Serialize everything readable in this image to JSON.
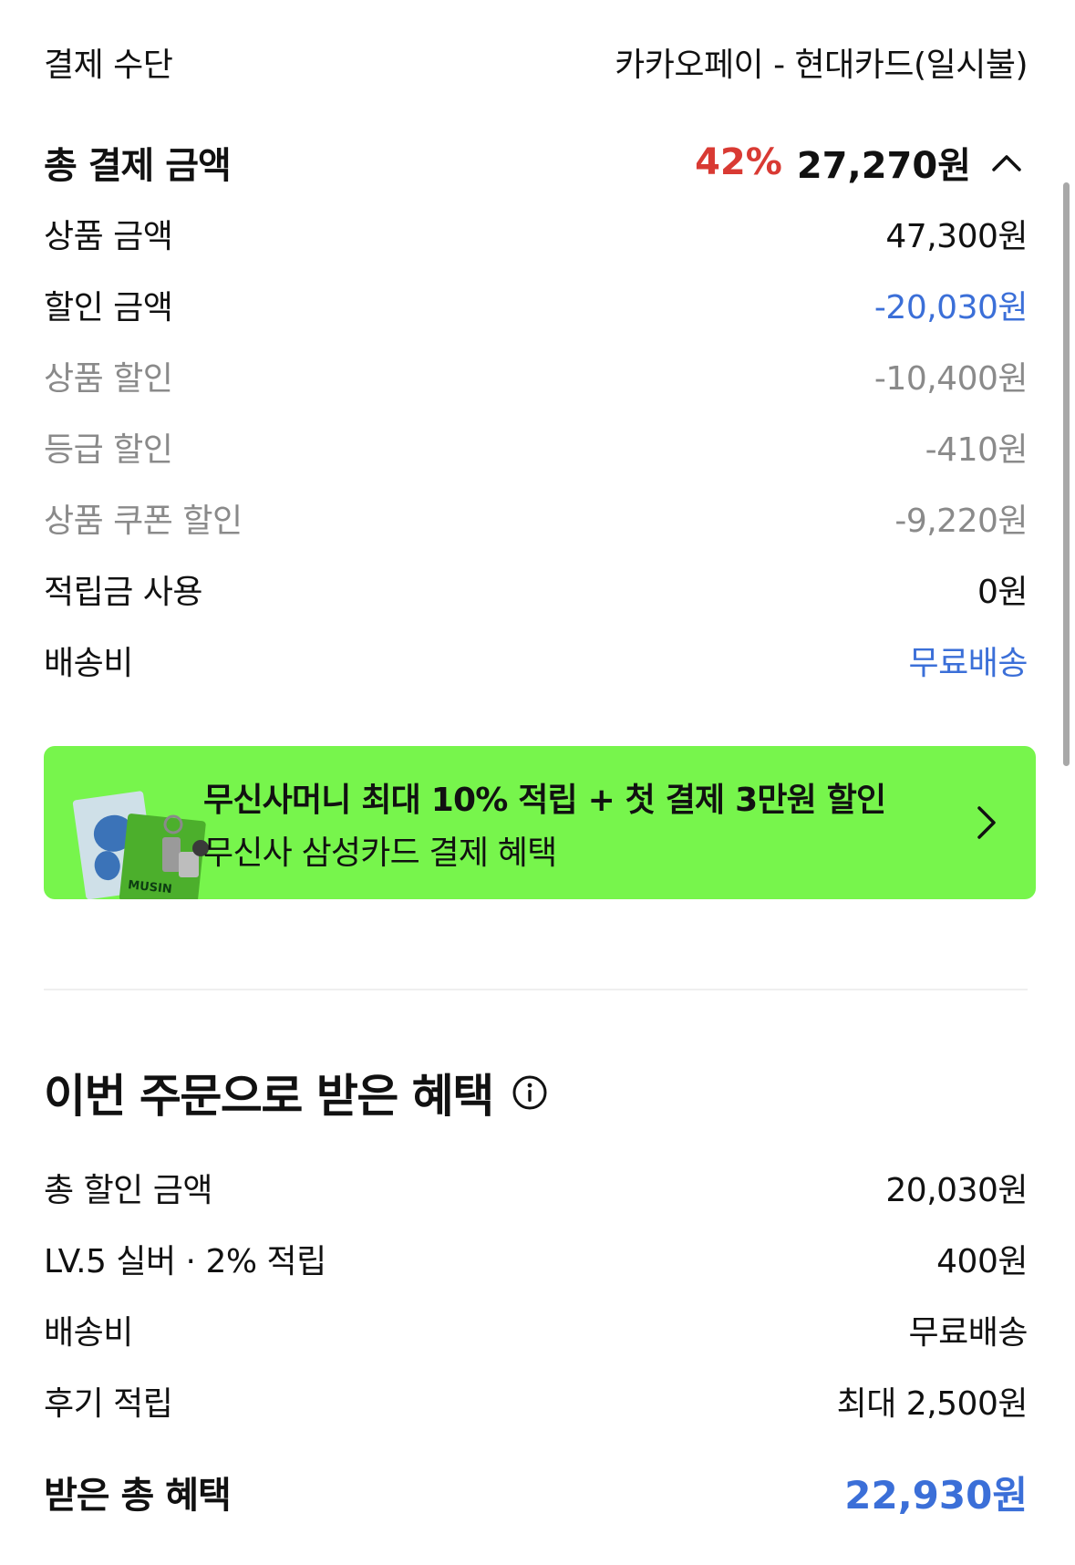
{
  "payment": {
    "method_label": "결제 수단",
    "method_value": "카카오페이 - 현대카드(일시불)"
  },
  "total": {
    "label": "총 결제 금액",
    "discount_rate": "42%",
    "amount": "27,270원"
  },
  "breakdown": [
    {
      "label": "상품 금액",
      "value": "47,300원"
    },
    {
      "label": "할인 금액",
      "value": "-20,030원"
    },
    {
      "label": "상품 할인",
      "value": "-10,400원"
    },
    {
      "label": "등급 할인",
      "value": "-410원"
    },
    {
      "label": "상품 쿠폰 할인",
      "value": "-9,220원"
    },
    {
      "label": "적립금 사용",
      "value": "0원"
    },
    {
      "label": "배송비",
      "value": "무료배송"
    }
  ],
  "banner": {
    "title": "무신사머니 최대 10% 적립 + 첫 결제 3만원 할인",
    "subtitle": "무신사 삼성카드 결제 혜택",
    "card_text": "MUSIN"
  },
  "benefits": {
    "title": "이번 주문으로 받은 혜택",
    "rows": [
      {
        "label": "총 할인 금액",
        "value": "20,030원"
      },
      {
        "label": "LV.5 실버 · 2% 적립",
        "value": "400원"
      },
      {
        "label": "배송비",
        "value": "무료배송"
      },
      {
        "label": "후기 적립",
        "value": "최대 2,500원"
      }
    ],
    "total_label": "받은 총 혜택",
    "total_value": "22,930원"
  },
  "colors": {
    "discount_red": "#d93a33",
    "accent_blue": "#3b6fd8",
    "banner_green": "#77f54c",
    "muted_gray": "#8a8a8a"
  }
}
